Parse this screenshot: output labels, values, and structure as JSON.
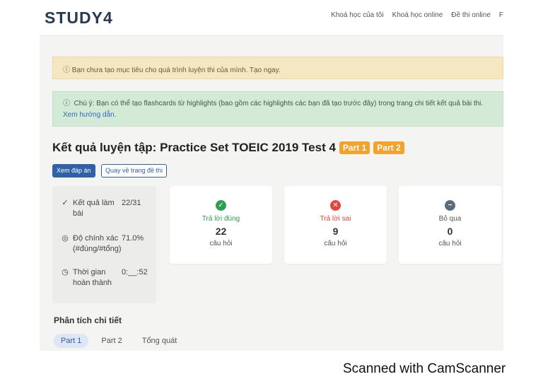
{
  "header": {
    "logo": "STUDY4",
    "nav": [
      "Khoá học của tôi",
      "Khoá học online",
      "Đề thi online",
      "F"
    ]
  },
  "alerts": {
    "goal_text": "Bạn chưa tạo mục tiêu cho quá trình luyện thi của mình.",
    "goal_link": "Tạo ngay.",
    "note_text": "Chú ý: Bạn có thể tạo flashcards từ highlights (bao gồm các highlights các bạn đã tạo trước đây) trong trang chi tiết kết quả bài thi.",
    "note_link": "Xem hướng dẫn."
  },
  "result": {
    "title": "Kết quả luyện tập: Practice Set TOEIC 2019 Test 4",
    "badges": [
      "Part 1",
      "Part 2"
    ],
    "view_answers_button": "Xem đáp án",
    "back_button": "Quay về trang đề thi"
  },
  "summary": {
    "result_label": "Kết quả làm bài",
    "result_value": "22/31",
    "accuracy_label": "Độ chính xác (#đúng/#tổng)",
    "accuracy_value": "71.0%",
    "time_label": "Thời gian hoàn thành",
    "time_value": "0:__:52"
  },
  "cards": [
    {
      "title": "Trả lời đúng",
      "value": "22",
      "unit": "câu hỏi",
      "color": "#2e9e4f",
      "icon": "check-circle-icon"
    },
    {
      "title": "Trả lời sai",
      "value": "9",
      "unit": "câu hỏi",
      "color": "#e0473c",
      "icon": "x-circle-icon"
    },
    {
      "title": "Bỏ qua",
      "value": "0",
      "unit": "câu hỏi",
      "color": "#5a6b7b",
      "icon": "minus-circle-icon"
    }
  ],
  "analysis": {
    "title": "Phân tích chi tiết",
    "tabs": [
      "Part 1",
      "Part 2",
      "Tổng quát"
    ]
  },
  "footer": {
    "scanner_text": "Scanned with CamScanner"
  }
}
